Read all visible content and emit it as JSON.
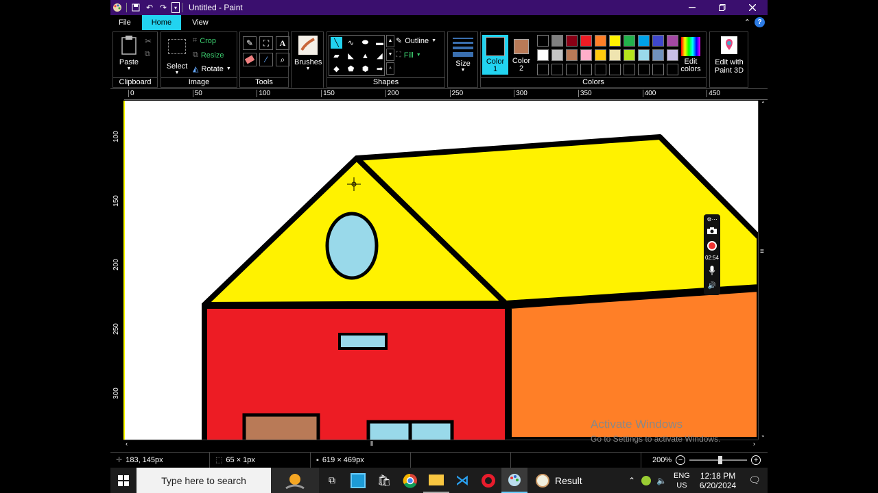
{
  "window": {
    "title": "Untitled - Paint"
  },
  "tabs": [
    {
      "label": "File"
    },
    {
      "label": "Home",
      "active": true
    },
    {
      "label": "View"
    }
  ],
  "help_label": "?",
  "ribbon": {
    "clipboard": {
      "paste": "Paste",
      "group": "Clipboard"
    },
    "image": {
      "select": "Select",
      "crop": "Crop",
      "resize": "Resize",
      "rotate": "Rotate",
      "group": "Image"
    },
    "tools": {
      "group": "Tools"
    },
    "brushes": {
      "label": "Brushes"
    },
    "shapes": {
      "outline": "Outline",
      "fill": "Fill",
      "group": "Shapes"
    },
    "size": {
      "label": "Size"
    },
    "colors": {
      "color1": "Color\n1",
      "color1_a": "Color",
      "color1_b": "1",
      "color2_a": "Color",
      "color2_b": "2",
      "edit": "Edit",
      "edit2": "colors",
      "group": "Colors",
      "color1_value": "#000000",
      "color2_value": "#b97a57",
      "swatches": [
        "#000000",
        "#7f7f7f",
        "#880015",
        "#ed1c24",
        "#ff7f27",
        "#fff200",
        "#22b14c",
        "#00a2e8",
        "#3f48cc",
        "#a349a4",
        "#ffffff",
        "#c3c3c3",
        "#b97a57",
        "#ffaec9",
        "#ffc90e",
        "#efe4b0",
        "#b5e61d",
        "#99d9ea",
        "#7092be",
        "#c8bfe7"
      ]
    },
    "paint3d": {
      "a": "Edit with",
      "b": "Paint 3D"
    }
  },
  "ruler_h": [
    "0",
    "50",
    "100",
    "150",
    "200",
    "250",
    "300",
    "350",
    "400",
    "450"
  ],
  "ruler_v": [
    "100",
    "150",
    "200",
    "250",
    "300"
  ],
  "recorder": {
    "time": "02:54"
  },
  "watermark": {
    "title": "Activate Windows",
    "subtitle": "Go to Settings to activate Windows."
  },
  "status": {
    "cursor": "183, 145px",
    "selection": "65 × 1px",
    "canvas": "619 × 469px",
    "zoom": "200%"
  },
  "taskbar": {
    "search_placeholder": "Type here to search",
    "result_label": "Result",
    "lang_a": "ENG",
    "lang_b": "US",
    "time": "12:18 PM",
    "date": "6/20/2024"
  }
}
